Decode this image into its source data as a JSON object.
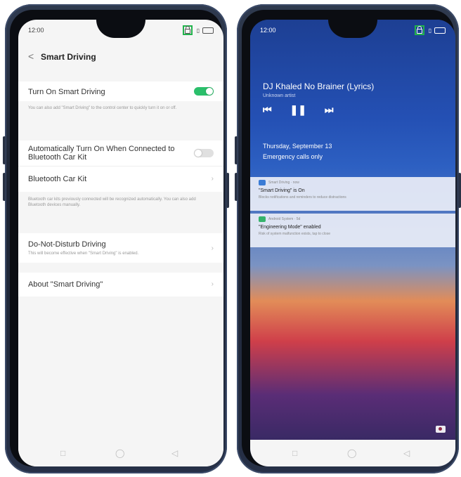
{
  "status": {
    "time": "12:00",
    "signal_icon": "signal-icon"
  },
  "settings": {
    "back_label": "<",
    "title": "Smart Driving",
    "turn_on": {
      "label": "Turn On Smart Driving",
      "sub": "You can also add \"Smart Driving\" to the control center to quickly turn it on or off.",
      "on": true
    },
    "auto_bt": {
      "label": "Automatically Turn On When Connected to Bluetooth Car Kit",
      "on": false
    },
    "bt_kit": {
      "label": "Bluetooth Car Kit",
      "sub": "Bluetooth car kits previously connected will be recognized automatically. You can also add Bluetooth devices manually."
    },
    "dnd": {
      "label": "Do-Not-Disturb Driving",
      "sub": "This will become effective when \"Smart Driving\" is enabled."
    },
    "about": {
      "label": "About \"Smart Driving\""
    },
    "chevron": "›",
    "accent": "#2bbf6b"
  },
  "lockscreen": {
    "song": "DJ Khaled No Brainer (Lyrics)",
    "artist": "Unknown artist",
    "controls": {
      "prev": "⏮",
      "pause": "❚❚",
      "next": "⏭"
    },
    "date": "Thursday, September 13",
    "emergency": "Emergency calls only",
    "notifications": [
      {
        "app": "Smart Driving · now",
        "title": "\"Smart Driving\" is On",
        "body": "Blocks notifications and reminders to reduce distractions",
        "color": "#3a7bd5"
      },
      {
        "app": "Android System · 5d",
        "title": "\"Engineering Mode\" enabled",
        "body": "Risk of system malfunction exists, tap to close",
        "color": "#35b36b"
      }
    ]
  },
  "navbar": {
    "square": "□",
    "circle": "◯",
    "back": "◁"
  }
}
